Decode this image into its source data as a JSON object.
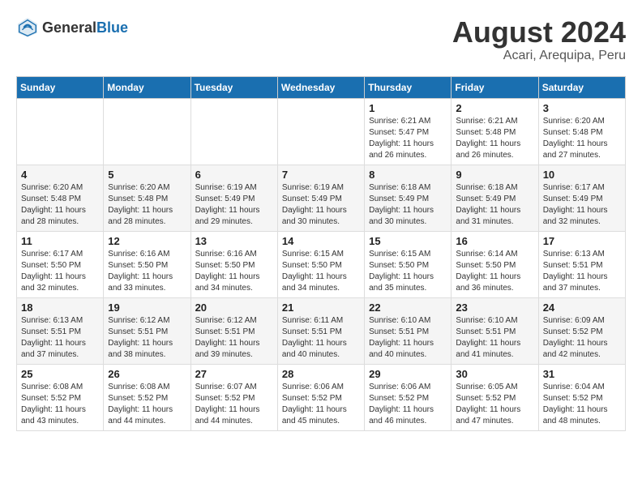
{
  "header": {
    "logo_general": "General",
    "logo_blue": "Blue",
    "title": "August 2024",
    "location": "Acari, Arequipa, Peru"
  },
  "days_of_week": [
    "Sunday",
    "Monday",
    "Tuesday",
    "Wednesday",
    "Thursday",
    "Friday",
    "Saturday"
  ],
  "weeks": [
    [
      {
        "day": "",
        "info": ""
      },
      {
        "day": "",
        "info": ""
      },
      {
        "day": "",
        "info": ""
      },
      {
        "day": "",
        "info": ""
      },
      {
        "day": "1",
        "info": "Sunrise: 6:21 AM\nSunset: 5:47 PM\nDaylight: 11 hours\nand 26 minutes."
      },
      {
        "day": "2",
        "info": "Sunrise: 6:21 AM\nSunset: 5:48 PM\nDaylight: 11 hours\nand 26 minutes."
      },
      {
        "day": "3",
        "info": "Sunrise: 6:20 AM\nSunset: 5:48 PM\nDaylight: 11 hours\nand 27 minutes."
      }
    ],
    [
      {
        "day": "4",
        "info": "Sunrise: 6:20 AM\nSunset: 5:48 PM\nDaylight: 11 hours\nand 28 minutes."
      },
      {
        "day": "5",
        "info": "Sunrise: 6:20 AM\nSunset: 5:48 PM\nDaylight: 11 hours\nand 28 minutes."
      },
      {
        "day": "6",
        "info": "Sunrise: 6:19 AM\nSunset: 5:49 PM\nDaylight: 11 hours\nand 29 minutes."
      },
      {
        "day": "7",
        "info": "Sunrise: 6:19 AM\nSunset: 5:49 PM\nDaylight: 11 hours\nand 30 minutes."
      },
      {
        "day": "8",
        "info": "Sunrise: 6:18 AM\nSunset: 5:49 PM\nDaylight: 11 hours\nand 30 minutes."
      },
      {
        "day": "9",
        "info": "Sunrise: 6:18 AM\nSunset: 5:49 PM\nDaylight: 11 hours\nand 31 minutes."
      },
      {
        "day": "10",
        "info": "Sunrise: 6:17 AM\nSunset: 5:49 PM\nDaylight: 11 hours\nand 32 minutes."
      }
    ],
    [
      {
        "day": "11",
        "info": "Sunrise: 6:17 AM\nSunset: 5:50 PM\nDaylight: 11 hours\nand 32 minutes."
      },
      {
        "day": "12",
        "info": "Sunrise: 6:16 AM\nSunset: 5:50 PM\nDaylight: 11 hours\nand 33 minutes."
      },
      {
        "day": "13",
        "info": "Sunrise: 6:16 AM\nSunset: 5:50 PM\nDaylight: 11 hours\nand 34 minutes."
      },
      {
        "day": "14",
        "info": "Sunrise: 6:15 AM\nSunset: 5:50 PM\nDaylight: 11 hours\nand 34 minutes."
      },
      {
        "day": "15",
        "info": "Sunrise: 6:15 AM\nSunset: 5:50 PM\nDaylight: 11 hours\nand 35 minutes."
      },
      {
        "day": "16",
        "info": "Sunrise: 6:14 AM\nSunset: 5:50 PM\nDaylight: 11 hours\nand 36 minutes."
      },
      {
        "day": "17",
        "info": "Sunrise: 6:13 AM\nSunset: 5:51 PM\nDaylight: 11 hours\nand 37 minutes."
      }
    ],
    [
      {
        "day": "18",
        "info": "Sunrise: 6:13 AM\nSunset: 5:51 PM\nDaylight: 11 hours\nand 37 minutes."
      },
      {
        "day": "19",
        "info": "Sunrise: 6:12 AM\nSunset: 5:51 PM\nDaylight: 11 hours\nand 38 minutes."
      },
      {
        "day": "20",
        "info": "Sunrise: 6:12 AM\nSunset: 5:51 PM\nDaylight: 11 hours\nand 39 minutes."
      },
      {
        "day": "21",
        "info": "Sunrise: 6:11 AM\nSunset: 5:51 PM\nDaylight: 11 hours\nand 40 minutes."
      },
      {
        "day": "22",
        "info": "Sunrise: 6:10 AM\nSunset: 5:51 PM\nDaylight: 11 hours\nand 40 minutes."
      },
      {
        "day": "23",
        "info": "Sunrise: 6:10 AM\nSunset: 5:51 PM\nDaylight: 11 hours\nand 41 minutes."
      },
      {
        "day": "24",
        "info": "Sunrise: 6:09 AM\nSunset: 5:52 PM\nDaylight: 11 hours\nand 42 minutes."
      }
    ],
    [
      {
        "day": "25",
        "info": "Sunrise: 6:08 AM\nSunset: 5:52 PM\nDaylight: 11 hours\nand 43 minutes."
      },
      {
        "day": "26",
        "info": "Sunrise: 6:08 AM\nSunset: 5:52 PM\nDaylight: 11 hours\nand 44 minutes."
      },
      {
        "day": "27",
        "info": "Sunrise: 6:07 AM\nSunset: 5:52 PM\nDaylight: 11 hours\nand 44 minutes."
      },
      {
        "day": "28",
        "info": "Sunrise: 6:06 AM\nSunset: 5:52 PM\nDaylight: 11 hours\nand 45 minutes."
      },
      {
        "day": "29",
        "info": "Sunrise: 6:06 AM\nSunset: 5:52 PM\nDaylight: 11 hours\nand 46 minutes."
      },
      {
        "day": "30",
        "info": "Sunrise: 6:05 AM\nSunset: 5:52 PM\nDaylight: 11 hours\nand 47 minutes."
      },
      {
        "day": "31",
        "info": "Sunrise: 6:04 AM\nSunset: 5:52 PM\nDaylight: 11 hours\nand 48 minutes."
      }
    ]
  ]
}
